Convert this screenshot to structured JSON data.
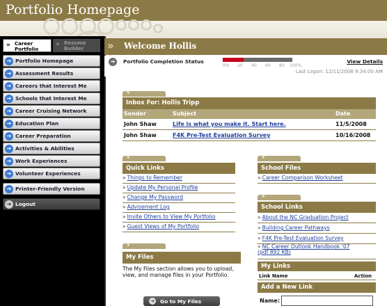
{
  "title": "Portfolio Homepage",
  "sidebar": {
    "tabs": [
      {
        "label": "Career Portfolio",
        "active": true
      },
      {
        "label": "Resume Builder",
        "active": false
      }
    ],
    "items": [
      {
        "label": "Portfolio Homepage"
      },
      {
        "label": "Assessment Results"
      },
      {
        "label": "Careers that Interest Me"
      },
      {
        "label": "Schools that Interest Me"
      },
      {
        "label": "Career Cruising Network"
      },
      {
        "label": "Education Plan"
      },
      {
        "label": "Career Preparation"
      },
      {
        "label": "Activities & Abilities"
      },
      {
        "label": "Work Experiences"
      },
      {
        "label": "Volunteer Experiences"
      },
      {
        "label": "Printer-Friendly Version"
      },
      {
        "label": "Logout"
      }
    ]
  },
  "welcome": {
    "text": "Welcome Hollis"
  },
  "status": {
    "label": "Portfolio Completion Status",
    "ticks": [
      "0%",
      "20",
      "40",
      "60",
      "80",
      "100%"
    ],
    "percent_complete": 30,
    "view_details": "View Details",
    "last_logon": "Last Logon: 12/11/2008 9:34:00 AM"
  },
  "inbox": {
    "title": "Inbox For: Hollis Tripp",
    "columns": [
      "Sender",
      "Subject",
      "Date"
    ],
    "rows": [
      {
        "sender": "John Shaw",
        "subject": "Life is what you make it. Start here.",
        "date": "11/5/2008"
      },
      {
        "sender": "John Shaw",
        "subject": "F4K Pre-Test Evaluation Survey",
        "date": "10/16/2008"
      }
    ]
  },
  "quick_links": {
    "title": "Quick Links",
    "items": [
      "Things to Remember",
      "Update My Personal Profile",
      "Change My Password",
      "Advisement Log",
      "Invite Others to View My Portfolio",
      "Guest Views of My Portfolio"
    ]
  },
  "school_files": {
    "title": "School Files",
    "items": [
      "Career Comparison Worksheet"
    ]
  },
  "school_links": {
    "title": "School Links",
    "items": [
      "About the NC Graduation Project",
      "Building Career Pathways",
      "F4K Pre-Test Evaluation Survey",
      "NC Career Outlook Handbook '07",
      "(pdf 892 KB)"
    ]
  },
  "my_links": {
    "title": "My Links",
    "columns": [
      "Link Name",
      "Action"
    ],
    "add_title": "Add a New Link",
    "name_label": "Name:",
    "name_value": ""
  },
  "my_files": {
    "title": "My Files",
    "description": "The My Files section allows you to upload, view, and manage files in your Portfolio.",
    "button": "Go to My Files"
  },
  "colors": {
    "brand": "#8c7a46",
    "brand_light": "#b3a67b",
    "progress": "#c4001b",
    "link": "#1f3f9b"
  }
}
